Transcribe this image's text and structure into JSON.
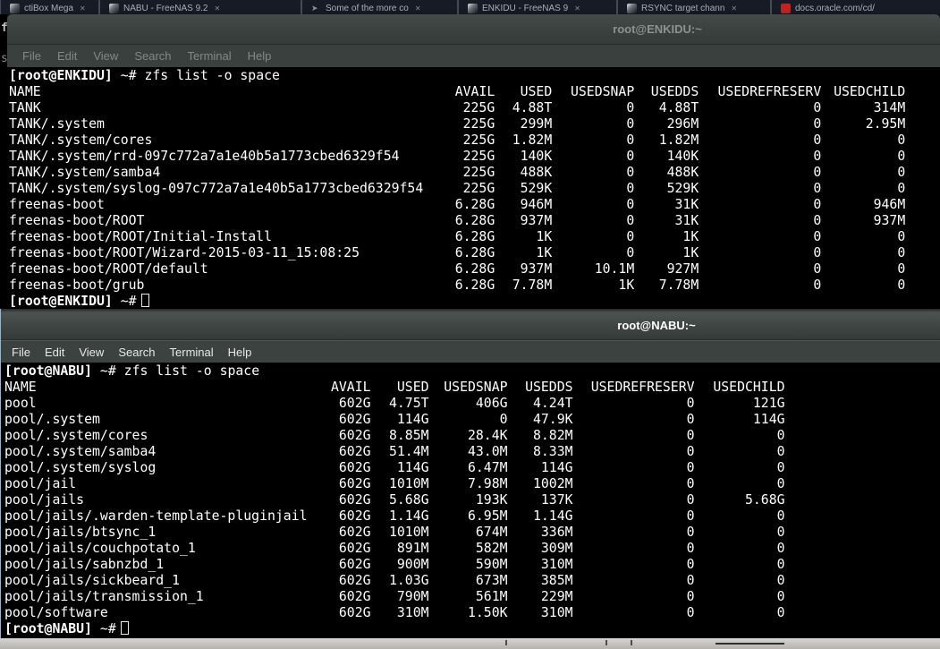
{
  "browser_tabs": [
    {
      "title": "ctiBox Mega",
      "close_label": "✕",
      "favicon": "page"
    },
    {
      "title": "NABU - FreeNAS 9.2",
      "close_label": "✕",
      "favicon": "freenas"
    },
    {
      "title": "Some of the more co",
      "close_label": "✕",
      "favicon": "cursor"
    },
    {
      "title": "ENKIDU - FreeNAS 9",
      "close_label": "✕",
      "favicon": "freenas"
    },
    {
      "title": "RSYNC target chann",
      "close_label": "✕",
      "favicon": "freenas"
    },
    {
      "title": "docs.oracle.com/cd/",
      "close_label": "",
      "favicon": "oracle"
    }
  ],
  "enkidu_terminal": {
    "window_title": "root@ENKIDU:~",
    "menu_items": [
      "File",
      "Edit",
      "View",
      "Search",
      "Terminal",
      "Help"
    ],
    "prompt_user": "[root@ENKIDU]",
    "prompt_suffix": "~#",
    "command": "zfs list -o space",
    "table": {
      "columns": [
        "NAME",
        "AVAIL",
        "USED",
        "USEDSNAP",
        "USEDDS",
        "USEDREFRESERV",
        "USEDCHILD"
      ],
      "rows": [
        [
          "TANK",
          "225G",
          "4.88T",
          "0",
          "4.88T",
          "0",
          "314M"
        ],
        [
          "TANK/.system",
          "225G",
          "299M",
          "0",
          "296M",
          "0",
          "2.95M"
        ],
        [
          "TANK/.system/cores",
          "225G",
          "1.82M",
          "0",
          "1.82M",
          "0",
          "0"
        ],
        [
          "TANK/.system/rrd-097c772a7a1e40b5a1773cbed6329f54",
          "225G",
          "140K",
          "0",
          "140K",
          "0",
          "0"
        ],
        [
          "TANK/.system/samba4",
          "225G",
          "488K",
          "0",
          "488K",
          "0",
          "0"
        ],
        [
          "TANK/.system/syslog-097c772a7a1e40b5a1773cbed6329f54",
          "225G",
          "529K",
          "0",
          "529K",
          "0",
          "0"
        ],
        [
          "freenas-boot",
          "6.28G",
          "946M",
          "0",
          "31K",
          "0",
          "946M"
        ],
        [
          "freenas-boot/ROOT",
          "6.28G",
          "937M",
          "0",
          "31K",
          "0",
          "937M"
        ],
        [
          "freenas-boot/ROOT/Initial-Install",
          "6.28G",
          "1K",
          "0",
          "1K",
          "0",
          "0"
        ],
        [
          "freenas-boot/ROOT/Wizard-2015-03-11_15:08:25",
          "6.28G",
          "1K",
          "0",
          "1K",
          "0",
          "0"
        ],
        [
          "freenas-boot/ROOT/default",
          "6.28G",
          "937M",
          "10.1M",
          "927M",
          "0",
          "0"
        ],
        [
          "freenas-boot/grub",
          "6.28G",
          "7.78M",
          "1K",
          "7.78M",
          "0",
          "0"
        ]
      ]
    }
  },
  "nabu_terminal": {
    "window_title": "root@NABU:~",
    "menu_items": [
      "File",
      "Edit",
      "View",
      "Search",
      "Terminal",
      "Help"
    ],
    "prompt_user": "[root@NABU]",
    "prompt_suffix": "~#",
    "command": "zfs list -o space",
    "table": {
      "columns": [
        "NAME",
        "AVAIL",
        "USED",
        "USEDSNAP",
        "USEDDS",
        "USEDREFRESERV",
        "USEDCHILD"
      ],
      "rows": [
        [
          "pool",
          "602G",
          "4.75T",
          "406G",
          "4.24T",
          "0",
          "121G"
        ],
        [
          "pool/.system",
          "602G",
          "114G",
          "0",
          "47.9K",
          "0",
          "114G"
        ],
        [
          "pool/.system/cores",
          "602G",
          "8.85M",
          "28.4K",
          "8.82M",
          "0",
          "0"
        ],
        [
          "pool/.system/samba4",
          "602G",
          "51.4M",
          "43.0M",
          "8.33M",
          "0",
          "0"
        ],
        [
          "pool/.system/syslog",
          "602G",
          "114G",
          "6.47M",
          "114G",
          "0",
          "0"
        ],
        [
          "pool/jail",
          "602G",
          "1010M",
          "7.98M",
          "1002M",
          "0",
          "0"
        ],
        [
          "pool/jails",
          "602G",
          "5.68G",
          "193K",
          "137K",
          "0",
          "5.68G"
        ],
        [
          "pool/jails/.warden-template-pluginjail",
          "602G",
          "1.14G",
          "6.95M",
          "1.14G",
          "0",
          "0"
        ],
        [
          "pool/jails/btsync_1",
          "602G",
          "1010M",
          "674M",
          "336M",
          "0",
          "0"
        ],
        [
          "pool/jails/couchpotato_1",
          "602G",
          "891M",
          "582M",
          "309M",
          "0",
          "0"
        ],
        [
          "pool/jails/sabnzbd_1",
          "602G",
          "900M",
          "590M",
          "310M",
          "0",
          "0"
        ],
        [
          "pool/jails/sickbeard_1",
          "602G",
          "1.03G",
          "673M",
          "385M",
          "0",
          "0"
        ],
        [
          "pool/jails/transmission_1",
          "602G",
          "790M",
          "561M",
          "229M",
          "0",
          "0"
        ],
        [
          "pool/software",
          "602G",
          "310M",
          "1.50K",
          "310M",
          "0",
          "0"
        ]
      ]
    }
  },
  "colors": {
    "terminal_bg": "#000000",
    "terminal_fg": "#ffffff",
    "titlebar_active": "#3f4644",
    "titlebar_inactive": "#3a403e",
    "inactive_text": "#8b928f",
    "active_title_text": "#ffffff",
    "oracle_favicon_red": "#c5221f",
    "tabbar_bg": "#0d0f16",
    "bottom_strip": "#c6c3c0"
  }
}
